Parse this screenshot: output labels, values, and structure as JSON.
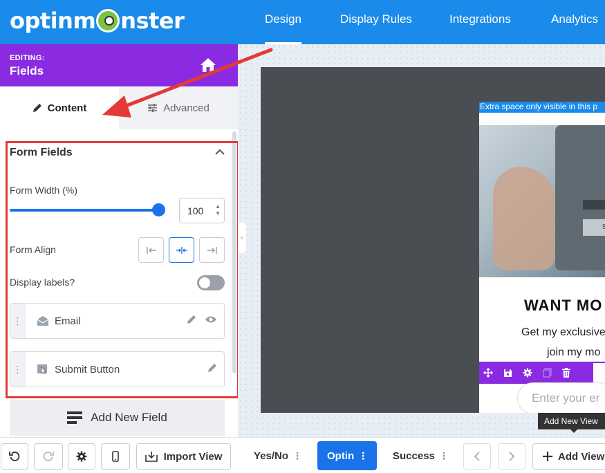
{
  "brand": {
    "logo_left": "optinm",
    "logo_right": "nster"
  },
  "nav": {
    "items": [
      "Design",
      "Display Rules",
      "Integrations",
      "Analytics"
    ],
    "active": "Design"
  },
  "editing": {
    "label": "EDITING:",
    "title": "Fields"
  },
  "tabs": {
    "content": "Content",
    "advanced": "Advanced"
  },
  "form_fields": {
    "title": "Form Fields",
    "width_label": "Form Width (%)",
    "width_value": "100",
    "width_fraction": 1.0,
    "align_label": "Form Align",
    "align_selected": "center",
    "labels_label": "Display labels?",
    "labels_enabled": false,
    "fields": [
      {
        "name": "Email",
        "icon": "envelope-icon"
      },
      {
        "name": "Submit Button",
        "icon": "cursor-icon"
      }
    ],
    "add_button": "Add New Field"
  },
  "bottom_left": {
    "import_view": "Import View"
  },
  "preview": {
    "extra_space": "Extra space only visible in this p",
    "headline": "WANT MO",
    "line1": "Get my exclusive",
    "line2": "join my mo",
    "input_placeholder": "Enter your er",
    "screen_text": "S"
  },
  "views": {
    "tabs": [
      "Yes/No",
      "Optin",
      "Success"
    ],
    "active": "Optin",
    "tooltip": "Add New View",
    "add_view": "Add View"
  },
  "colors": {
    "topbar": "#1a8bea",
    "editing": "#8a2be2",
    "accent": "#1a73e8",
    "highlight": "#e53935"
  }
}
